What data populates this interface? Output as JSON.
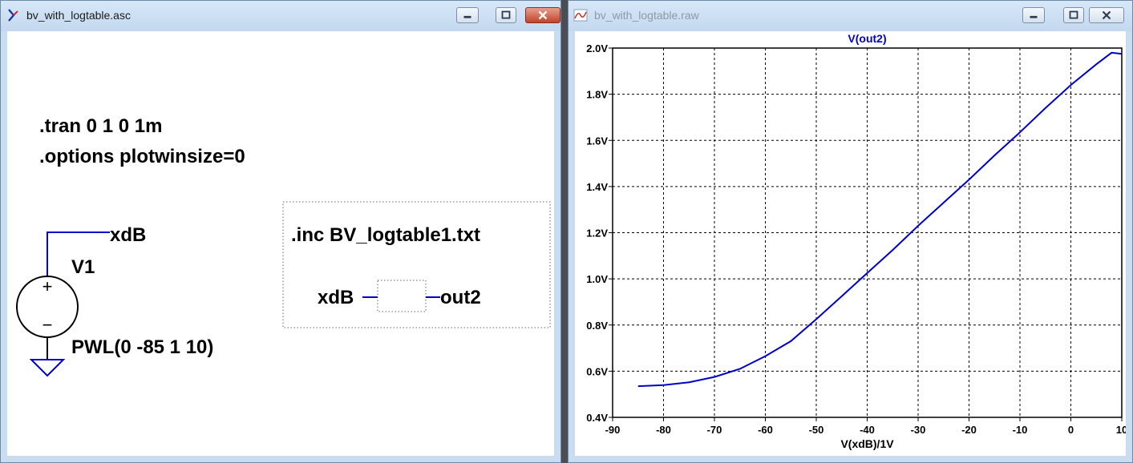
{
  "schematic_window": {
    "title": "bv_with_logtable.asc",
    "directives": {
      "tran": ".tran 0 1 0 1m",
      "options": ".options plotwinsize=0",
      "inc": ".inc BV_logtable1.txt"
    },
    "source": {
      "ref": "V1",
      "value": "PWL(0 -85 1 10)",
      "plus_symbol": "+",
      "minus_symbol": "−"
    },
    "nets": {
      "top": "xdB",
      "behavioral_in": "xdB",
      "behavioral_out": "out2"
    },
    "wire_color": "#0000c8"
  },
  "waveform_window": {
    "title": "bv_with_logtable.raw",
    "trace_color": "#0000c8"
  },
  "chart_data": {
    "type": "line",
    "title": "V(out2)",
    "xlabel": "V(xdB)/1V",
    "ylabel": "",
    "xlim": [
      -90,
      10
    ],
    "ylim": [
      0.4,
      2.0
    ],
    "xticks": [
      "-90",
      "-80",
      "-70",
      "-60",
      "-50",
      "-40",
      "-30",
      "-20",
      "-10",
      "0",
      "10"
    ],
    "yticks": [
      "0.4V",
      "0.6V",
      "0.8V",
      "1.0V",
      "1.2V",
      "1.4V",
      "1.6V",
      "1.8V",
      "2.0V"
    ],
    "grid": true,
    "series": [
      {
        "name": "V(out2)",
        "x": [
          -85,
          -80,
          -75,
          -70,
          -65,
          -60,
          -55,
          -50,
          -45,
          -40,
          -35,
          -30,
          -25,
          -20,
          -15,
          -10,
          -5,
          0,
          5,
          8,
          10
        ],
        "y": [
          0.535,
          0.54,
          0.552,
          0.575,
          0.61,
          0.665,
          0.73,
          0.825,
          0.925,
          1.025,
          1.125,
          1.23,
          1.33,
          1.43,
          1.535,
          1.635,
          1.74,
          1.84,
          1.93,
          1.98,
          1.975
        ]
      }
    ]
  }
}
